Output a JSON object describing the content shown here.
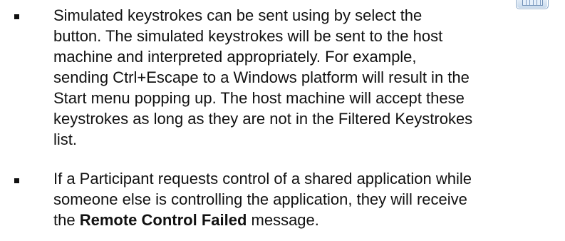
{
  "bullets": [
    {
      "lines": [
        "Simulated keystrokes can be sent using by select the",
        "button.  The simulated keystrokes will be sent to the host",
        "machine and interpreted appropriately.  For example,",
        "sending Ctrl+Escape to a Windows platform will result in the",
        "Start menu popping up.  The host machine will accept these",
        "keystrokes as long as they are not in the Filtered Keystrokes",
        "list."
      ],
      "inline_icon": "keyboard-icon"
    },
    {
      "line1": "If a Participant requests control of a shared application while",
      "line2": "someone else is controlling the application, they will receive",
      "line3_prefix": "the ",
      "line3_bold": "Remote Control Failed",
      "line3_suffix": " message."
    }
  ]
}
